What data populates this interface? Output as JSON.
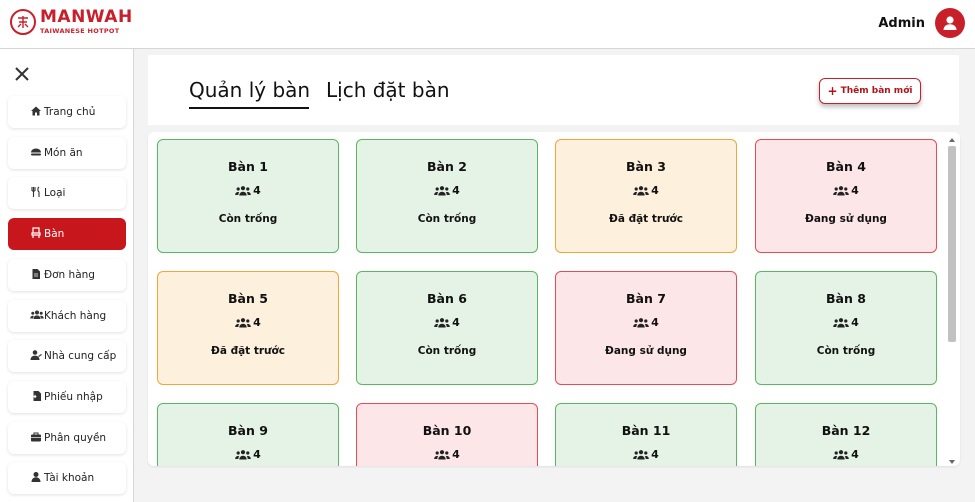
{
  "brand": {
    "name": "MANWAH",
    "tagline": "TAIWANESE HOTPOT",
    "color": "#c8202a"
  },
  "header": {
    "user_name": "Admin"
  },
  "sidebar": {
    "items": [
      {
        "label": "Trang chủ",
        "icon": "home-icon",
        "active": false
      },
      {
        "label": "Món ăn",
        "icon": "dish-icon",
        "active": false
      },
      {
        "label": "Loại",
        "icon": "utensils-icon",
        "active": false
      },
      {
        "label": "Bàn",
        "icon": "chair-icon",
        "active": true
      },
      {
        "label": "Đơn hàng",
        "icon": "document-icon",
        "active": false
      },
      {
        "label": "Khách hàng",
        "icon": "users-icon",
        "active": false
      },
      {
        "label": "Nhà cung cấp",
        "icon": "user-tie-icon",
        "active": false
      },
      {
        "label": "Phiếu nhập",
        "icon": "file-import-icon",
        "active": false
      },
      {
        "label": "Phân quyền",
        "icon": "briefcase-icon",
        "active": false
      },
      {
        "label": "Tài khoản",
        "icon": "user-icon",
        "active": false
      }
    ]
  },
  "tabs": [
    {
      "label": "Quản lý bàn",
      "active": true
    },
    {
      "label": "Lịch đặt bàn",
      "active": false
    }
  ],
  "actions": {
    "add_table_label": "Thêm bàn mới"
  },
  "status_colors": {
    "free": "#5bb75f",
    "booked": "#f2a53a",
    "busy": "#e84b51"
  },
  "tables": [
    {
      "name": "Bàn 1",
      "seats": "4",
      "status": "Còn trống",
      "state": "free"
    },
    {
      "name": "Bàn 2",
      "seats": "4",
      "status": "Còn trống",
      "state": "free"
    },
    {
      "name": "Bàn 3",
      "seats": "4",
      "status": "Đã đặt trước",
      "state": "booked"
    },
    {
      "name": "Bàn 4",
      "seats": "4",
      "status": "Đang sử dụng",
      "state": "busy"
    },
    {
      "name": "Bàn 5",
      "seats": "4",
      "status": "Đã đặt trước",
      "state": "booked"
    },
    {
      "name": "Bàn 6",
      "seats": "4",
      "status": "Còn trống",
      "state": "free"
    },
    {
      "name": "Bàn 7",
      "seats": "4",
      "status": "Đang sử dụng",
      "state": "busy"
    },
    {
      "name": "Bàn 8",
      "seats": "4",
      "status": "Còn trống",
      "state": "free"
    },
    {
      "name": "Bàn 9",
      "seats": "4",
      "status": "",
      "state": "free"
    },
    {
      "name": "Bàn 10",
      "seats": "4",
      "status": "",
      "state": "busy"
    },
    {
      "name": "Bàn 11",
      "seats": "4",
      "status": "",
      "state": "free"
    },
    {
      "name": "Bàn 12",
      "seats": "4",
      "status": "",
      "state": "free"
    }
  ]
}
